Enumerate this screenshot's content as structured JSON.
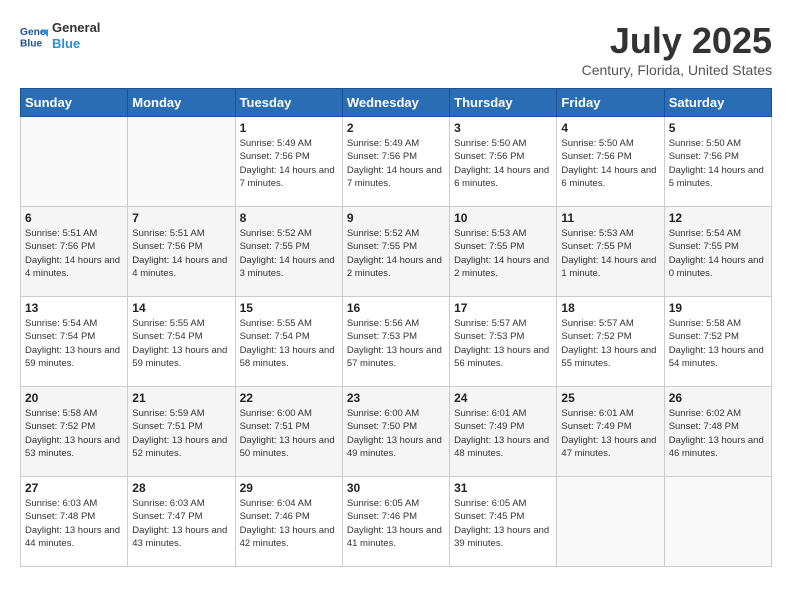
{
  "header": {
    "logo_line1": "General",
    "logo_line2": "Blue",
    "month_year": "July 2025",
    "location": "Century, Florida, United States"
  },
  "weekdays": [
    "Sunday",
    "Monday",
    "Tuesday",
    "Wednesday",
    "Thursday",
    "Friday",
    "Saturday"
  ],
  "weeks": [
    [
      {
        "day": "",
        "info": ""
      },
      {
        "day": "",
        "info": ""
      },
      {
        "day": "1",
        "info": "Sunrise: 5:49 AM\nSunset: 7:56 PM\nDaylight: 14 hours and 7 minutes."
      },
      {
        "day": "2",
        "info": "Sunrise: 5:49 AM\nSunset: 7:56 PM\nDaylight: 14 hours and 7 minutes."
      },
      {
        "day": "3",
        "info": "Sunrise: 5:50 AM\nSunset: 7:56 PM\nDaylight: 14 hours and 6 minutes."
      },
      {
        "day": "4",
        "info": "Sunrise: 5:50 AM\nSunset: 7:56 PM\nDaylight: 14 hours and 6 minutes."
      },
      {
        "day": "5",
        "info": "Sunrise: 5:50 AM\nSunset: 7:56 PM\nDaylight: 14 hours and 5 minutes."
      }
    ],
    [
      {
        "day": "6",
        "info": "Sunrise: 5:51 AM\nSunset: 7:56 PM\nDaylight: 14 hours and 4 minutes."
      },
      {
        "day": "7",
        "info": "Sunrise: 5:51 AM\nSunset: 7:56 PM\nDaylight: 14 hours and 4 minutes."
      },
      {
        "day": "8",
        "info": "Sunrise: 5:52 AM\nSunset: 7:55 PM\nDaylight: 14 hours and 3 minutes."
      },
      {
        "day": "9",
        "info": "Sunrise: 5:52 AM\nSunset: 7:55 PM\nDaylight: 14 hours and 2 minutes."
      },
      {
        "day": "10",
        "info": "Sunrise: 5:53 AM\nSunset: 7:55 PM\nDaylight: 14 hours and 2 minutes."
      },
      {
        "day": "11",
        "info": "Sunrise: 5:53 AM\nSunset: 7:55 PM\nDaylight: 14 hours and 1 minute."
      },
      {
        "day": "12",
        "info": "Sunrise: 5:54 AM\nSunset: 7:55 PM\nDaylight: 14 hours and 0 minutes."
      }
    ],
    [
      {
        "day": "13",
        "info": "Sunrise: 5:54 AM\nSunset: 7:54 PM\nDaylight: 13 hours and 59 minutes."
      },
      {
        "day": "14",
        "info": "Sunrise: 5:55 AM\nSunset: 7:54 PM\nDaylight: 13 hours and 59 minutes."
      },
      {
        "day": "15",
        "info": "Sunrise: 5:55 AM\nSunset: 7:54 PM\nDaylight: 13 hours and 58 minutes."
      },
      {
        "day": "16",
        "info": "Sunrise: 5:56 AM\nSunset: 7:53 PM\nDaylight: 13 hours and 57 minutes."
      },
      {
        "day": "17",
        "info": "Sunrise: 5:57 AM\nSunset: 7:53 PM\nDaylight: 13 hours and 56 minutes."
      },
      {
        "day": "18",
        "info": "Sunrise: 5:57 AM\nSunset: 7:52 PM\nDaylight: 13 hours and 55 minutes."
      },
      {
        "day": "19",
        "info": "Sunrise: 5:58 AM\nSunset: 7:52 PM\nDaylight: 13 hours and 54 minutes."
      }
    ],
    [
      {
        "day": "20",
        "info": "Sunrise: 5:58 AM\nSunset: 7:52 PM\nDaylight: 13 hours and 53 minutes."
      },
      {
        "day": "21",
        "info": "Sunrise: 5:59 AM\nSunset: 7:51 PM\nDaylight: 13 hours and 52 minutes."
      },
      {
        "day": "22",
        "info": "Sunrise: 6:00 AM\nSunset: 7:51 PM\nDaylight: 13 hours and 50 minutes."
      },
      {
        "day": "23",
        "info": "Sunrise: 6:00 AM\nSunset: 7:50 PM\nDaylight: 13 hours and 49 minutes."
      },
      {
        "day": "24",
        "info": "Sunrise: 6:01 AM\nSunset: 7:49 PM\nDaylight: 13 hours and 48 minutes."
      },
      {
        "day": "25",
        "info": "Sunrise: 6:01 AM\nSunset: 7:49 PM\nDaylight: 13 hours and 47 minutes."
      },
      {
        "day": "26",
        "info": "Sunrise: 6:02 AM\nSunset: 7:48 PM\nDaylight: 13 hours and 46 minutes."
      }
    ],
    [
      {
        "day": "27",
        "info": "Sunrise: 6:03 AM\nSunset: 7:48 PM\nDaylight: 13 hours and 44 minutes."
      },
      {
        "day": "28",
        "info": "Sunrise: 6:03 AM\nSunset: 7:47 PM\nDaylight: 13 hours and 43 minutes."
      },
      {
        "day": "29",
        "info": "Sunrise: 6:04 AM\nSunset: 7:46 PM\nDaylight: 13 hours and 42 minutes."
      },
      {
        "day": "30",
        "info": "Sunrise: 6:05 AM\nSunset: 7:46 PM\nDaylight: 13 hours and 41 minutes."
      },
      {
        "day": "31",
        "info": "Sunrise: 6:05 AM\nSunset: 7:45 PM\nDaylight: 13 hours and 39 minutes."
      },
      {
        "day": "",
        "info": ""
      },
      {
        "day": "",
        "info": ""
      }
    ]
  ]
}
